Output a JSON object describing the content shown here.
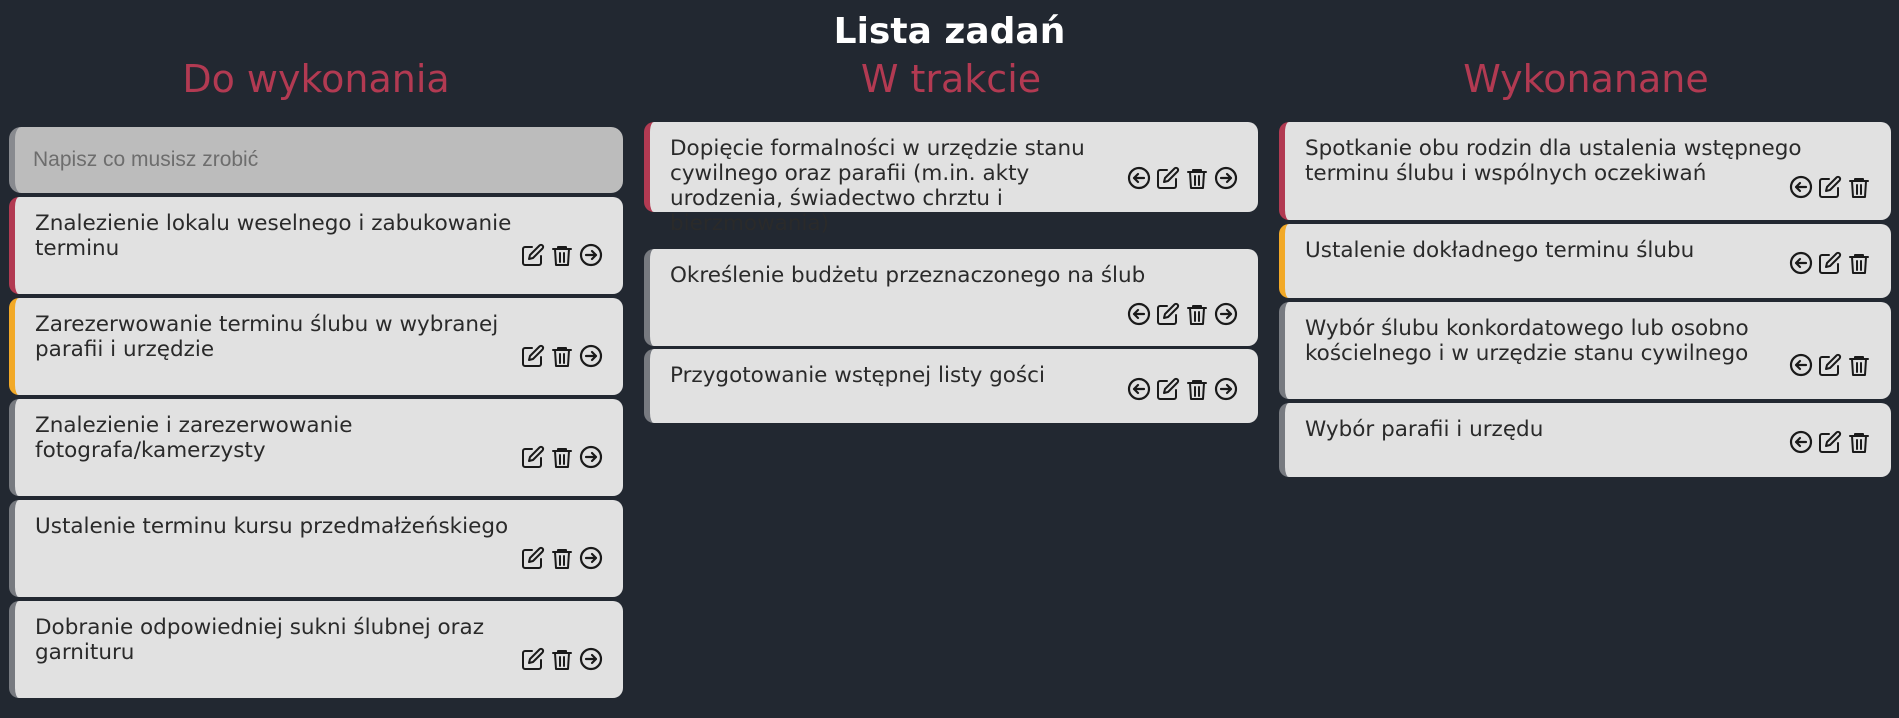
{
  "page_title": "Lista zadań",
  "colors": {
    "background": "#222831",
    "column_title": "#b23a52",
    "card": "#e1e1e1",
    "priority_high": "#b23a52",
    "priority_medium": "#f2a927",
    "priority_low": "#777a80"
  },
  "icons": {
    "move_left": "circle-arrow-left-icon",
    "edit": "edit-icon",
    "delete": "trash-icon",
    "move_right": "circle-arrow-right-icon"
  },
  "columns": [
    {
      "title": "Do wykonania",
      "input_placeholder": "Napisz co musisz zrobić",
      "tasks": [
        {
          "text": "Znalezienie lokalu weselnego i zabukowanie terminu",
          "priority": "high"
        },
        {
          "text": "Zarezerwowanie terminu ślubu w wybranej parafii i urzędzie",
          "priority": "medium"
        },
        {
          "text": "Znalezienie i zarezerwowanie fotografa/kamerzysty",
          "priority": "low"
        },
        {
          "text": "Ustalenie terminu kursu przedmałżeńskiego",
          "priority": "low"
        },
        {
          "text": "Dobranie odpowiedniej sukni ślubnej oraz garnituru",
          "priority": "low"
        }
      ]
    },
    {
      "title": "W trakcie",
      "tasks": [
        {
          "text": "Dopięcie formalności w urzędzie stanu cywilnego oraz parafii (m.in. akty urodzenia, świadectwo chrztu i bierzmowania)",
          "priority": "high"
        },
        {
          "text": "Określenie budżetu przeznaczonego na ślub",
          "priority": "low"
        },
        {
          "text": "Przygotowanie wstępnej listy gości",
          "priority": "low"
        }
      ]
    },
    {
      "title": "Wykonanane",
      "tasks": [
        {
          "text": "Spotkanie obu rodzin dla ustalenia wstępnego terminu ślubu i wspólnych oczekiwań",
          "priority": "high"
        },
        {
          "text": "Ustalenie dokładnego terminu ślubu",
          "priority": "medium"
        },
        {
          "text": "Wybór ślubu konkordatowego lub osobno kościelnego i w urzędzie stanu cywilnego",
          "priority": "low"
        },
        {
          "text": "Wybór parafii i urzędu",
          "priority": "low"
        }
      ]
    }
  ]
}
